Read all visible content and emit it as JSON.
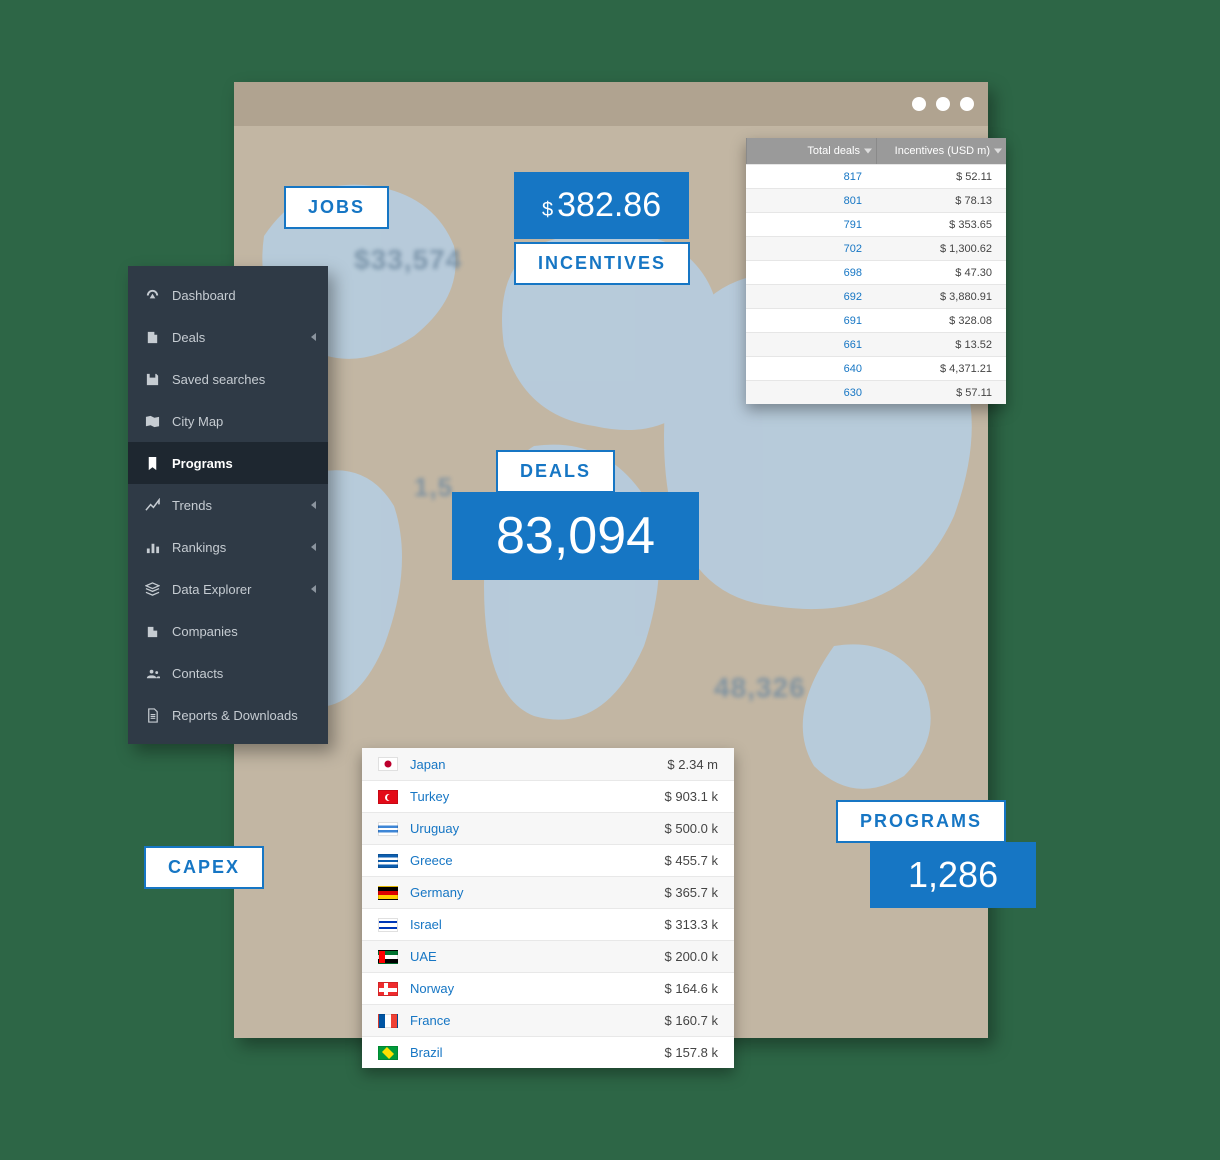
{
  "labels": {
    "jobs": "JOBS",
    "incentives": "INCENTIVES",
    "deals": "DEALS",
    "capex": "CAPEX",
    "programs": "PROGRAMS"
  },
  "figures": {
    "incentives_currency": "$",
    "incentives_value": "382.86",
    "deals_value": "83,094",
    "programs_value": "1,286"
  },
  "map_numbers": {
    "n1": "$33,574",
    "n2": "1,5",
    "n3": "48,326"
  },
  "sidebar": {
    "items": [
      {
        "label": "Dashboard",
        "icon": "dashboard-icon",
        "expandable": false
      },
      {
        "label": "Deals",
        "icon": "deals-icon",
        "expandable": true
      },
      {
        "label": "Saved searches",
        "icon": "save-icon",
        "expandable": false
      },
      {
        "label": "City Map",
        "icon": "map-icon",
        "expandable": false
      },
      {
        "label": "Programs",
        "icon": "bookmark-icon",
        "expandable": false,
        "active": true
      },
      {
        "label": "Trends",
        "icon": "trends-icon",
        "expandable": true
      },
      {
        "label": "Rankings",
        "icon": "rankings-icon",
        "expandable": true
      },
      {
        "label": "Data Explorer",
        "icon": "layers-icon",
        "expandable": true
      },
      {
        "label": "Companies",
        "icon": "company-icon",
        "expandable": false
      },
      {
        "label": "Contacts",
        "icon": "contacts-icon",
        "expandable": false
      },
      {
        "label": "Reports & Downloads",
        "icon": "report-icon",
        "expandable": false
      }
    ]
  },
  "deals_popup": {
    "col1": "Total deals",
    "col2": "Incentives (USD m)",
    "rows": [
      {
        "deals": "817",
        "incentives": "$ 52.11"
      },
      {
        "deals": "801",
        "incentives": "$ 78.13"
      },
      {
        "deals": "791",
        "incentives": "$ 353.65"
      },
      {
        "deals": "702",
        "incentives": "$ 1,300.62"
      },
      {
        "deals": "698",
        "incentives": "$ 47.30"
      },
      {
        "deals": "692",
        "incentives": "$ 3,880.91"
      },
      {
        "deals": "691",
        "incentives": "$ 328.08"
      },
      {
        "deals": "661",
        "incentives": "$ 13.52"
      },
      {
        "deals": "640",
        "incentives": "$ 4,371.21"
      },
      {
        "deals": "630",
        "incentives": "$ 57.11"
      }
    ]
  },
  "country_table": {
    "rows": [
      {
        "flag": "jp",
        "country": "Japan",
        "amount": "$ 2.34 m"
      },
      {
        "flag": "tr",
        "country": "Turkey",
        "amount": "$ 903.1 k"
      },
      {
        "flag": "uy",
        "country": "Uruguay",
        "amount": "$ 500.0 k"
      },
      {
        "flag": "gr",
        "country": "Greece",
        "amount": "$ 455.7 k"
      },
      {
        "flag": "de",
        "country": "Germany",
        "amount": "$ 365.7 k"
      },
      {
        "flag": "il",
        "country": "Israel",
        "amount": "$ 313.3 k"
      },
      {
        "flag": "ae",
        "country": "UAE",
        "amount": "$ 200.0 k"
      },
      {
        "flag": "no",
        "country": "Norway",
        "amount": "$ 164.6 k"
      },
      {
        "flag": "fr",
        "country": "France",
        "amount": "$ 160.7 k"
      },
      {
        "flag": "br",
        "country": "Brazil",
        "amount": "$ 157.8 k"
      }
    ]
  }
}
